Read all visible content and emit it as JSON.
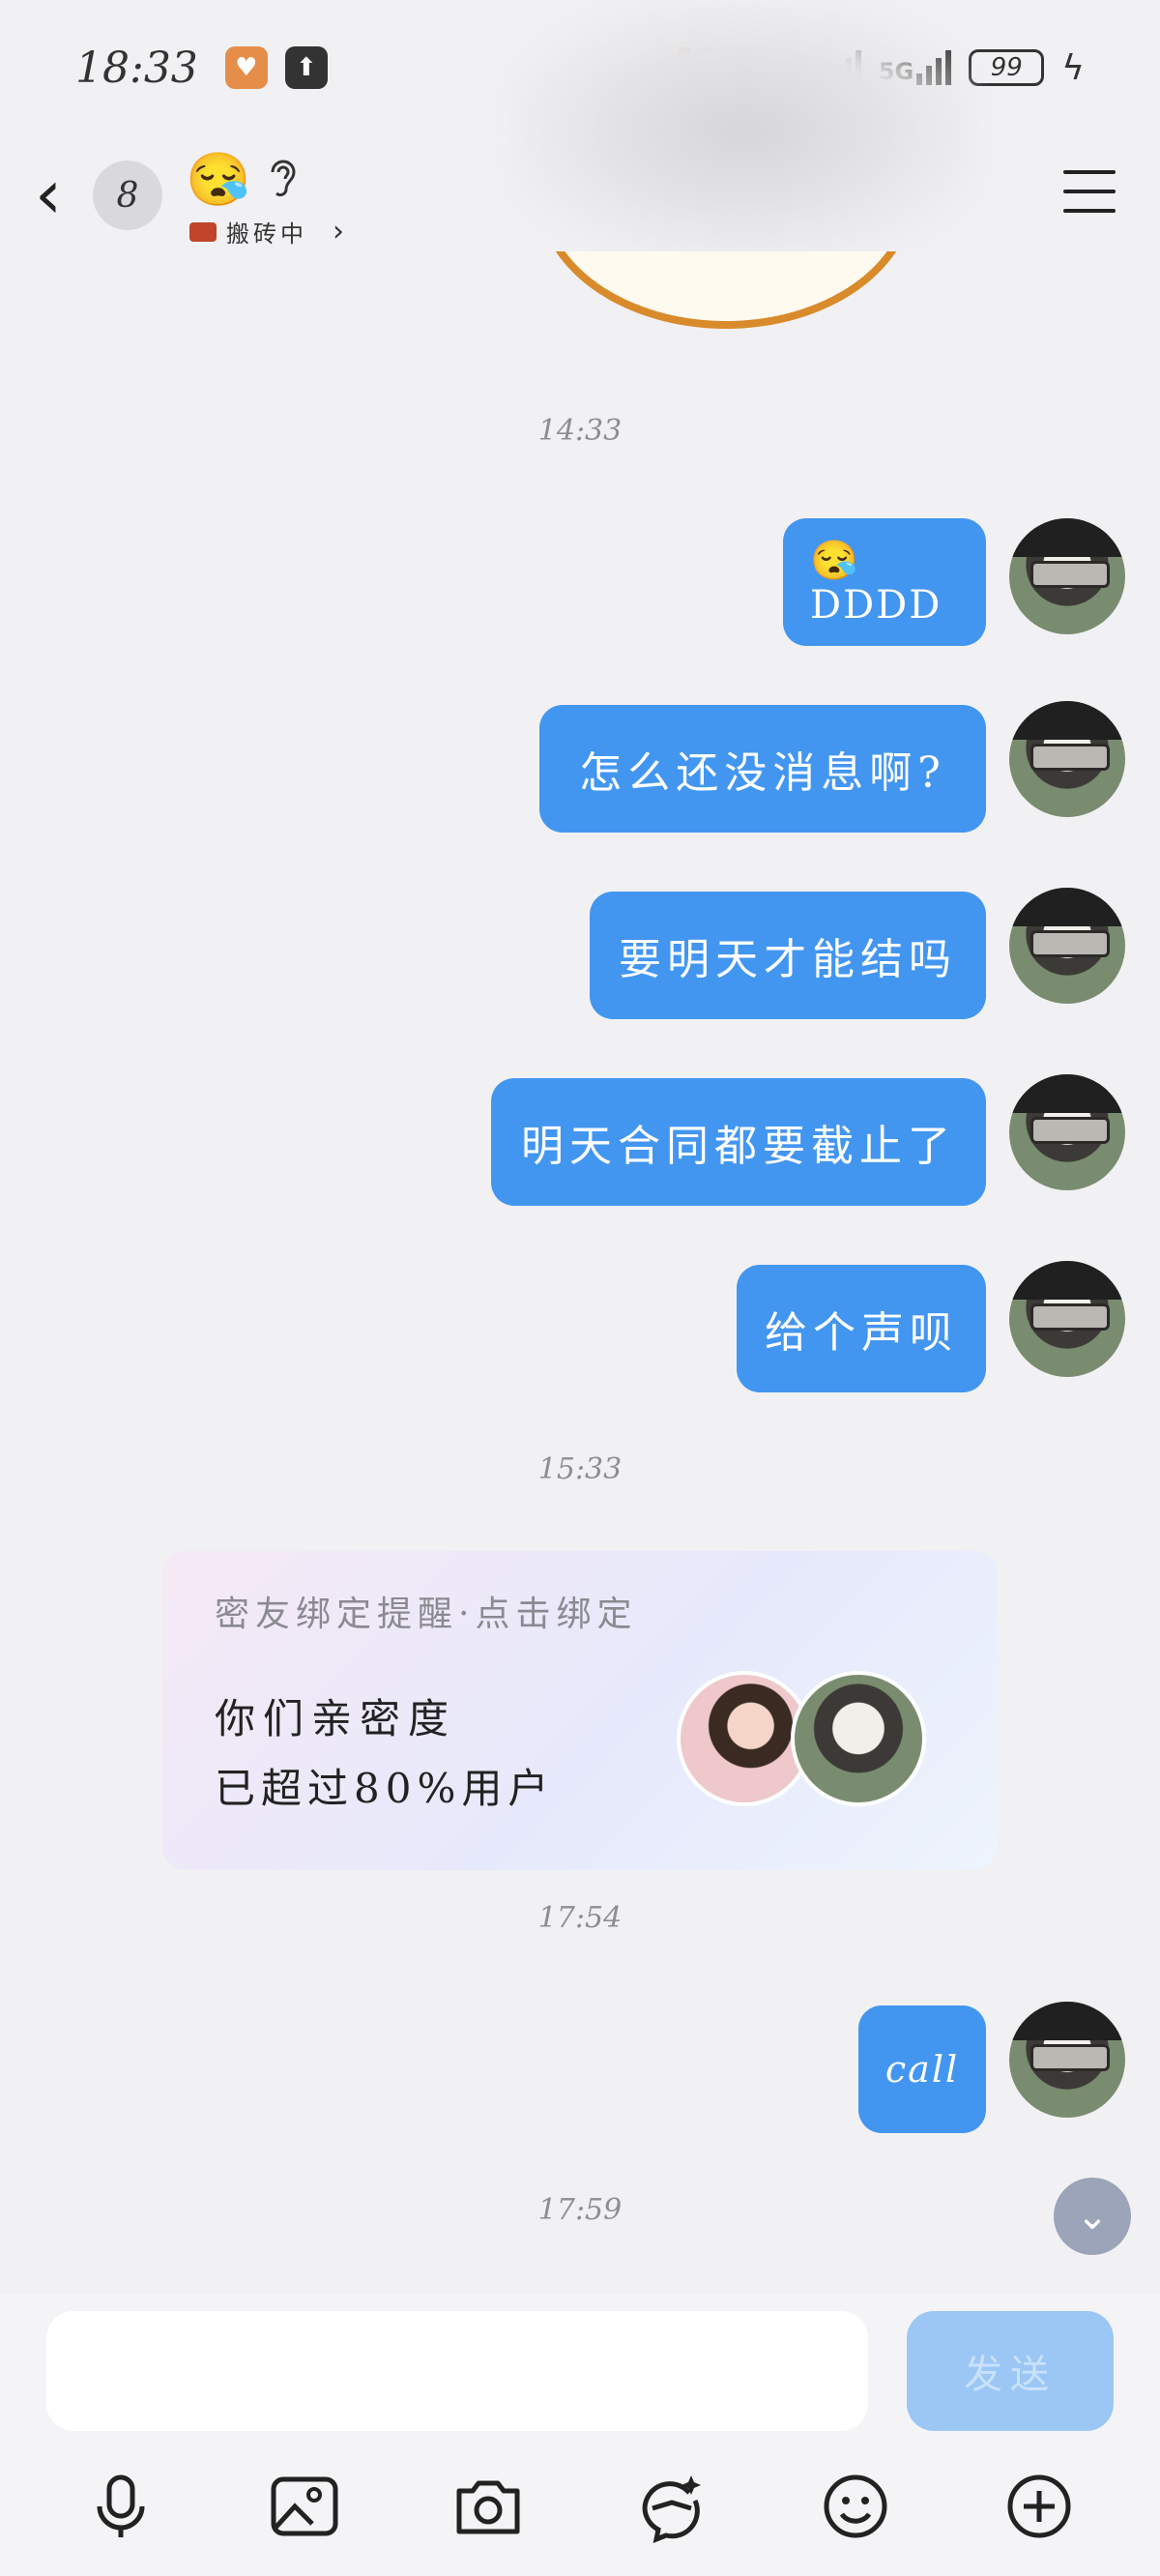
{
  "status_bar": {
    "time": "18:33",
    "network_1": "5G",
    "network_2": "5G",
    "battery": "99",
    "colors": {
      "health_app": "#e58e4a",
      "upload_app": "#333333"
    }
  },
  "header": {
    "unread_count": "8",
    "mood_emoji": "😪",
    "status_text": "搬砖中",
    "icons": [
      "back-icon",
      "ear-icon",
      "brick-icon",
      "chevron-right-icon",
      "menu-icon"
    ]
  },
  "messages": [
    {
      "timestamp": "14:33"
    },
    {
      "text": "😪DDDD"
    },
    {
      "text": "怎么还没消息啊?"
    },
    {
      "text": "要明天才能结吗"
    },
    {
      "text": "明天合同都要截止了"
    },
    {
      "text": "给个声呗"
    },
    {
      "timestamp": "15:33"
    },
    {
      "timestamp": "17:54"
    },
    {
      "text": "call"
    },
    {
      "timestamp": "17:59"
    }
  ],
  "timestamps": [
    "14:33",
    "15:33",
    "17:54",
    "17:59"
  ],
  "outgoing": [
    "😪DDDD",
    "怎么还没消息啊?",
    "要明天才能结吗",
    "明天合同都要截止了",
    "给个声呗",
    "call"
  ],
  "intimacy_card": {
    "title": "密友绑定提醒·点击绑定",
    "line1": "你们亲密度",
    "line2": "已超过80%用户"
  },
  "input": {
    "value": "",
    "send_label": "发送"
  },
  "toolbar": {
    "icons": [
      "microphone-icon",
      "image-icon",
      "camera-icon",
      "sticker-icon",
      "emoji-icon",
      "plus-icon"
    ]
  },
  "colors": {
    "bubble": "#4396f0",
    "send_disabled": "#9cc7f5",
    "background": "#f1f1f4"
  }
}
